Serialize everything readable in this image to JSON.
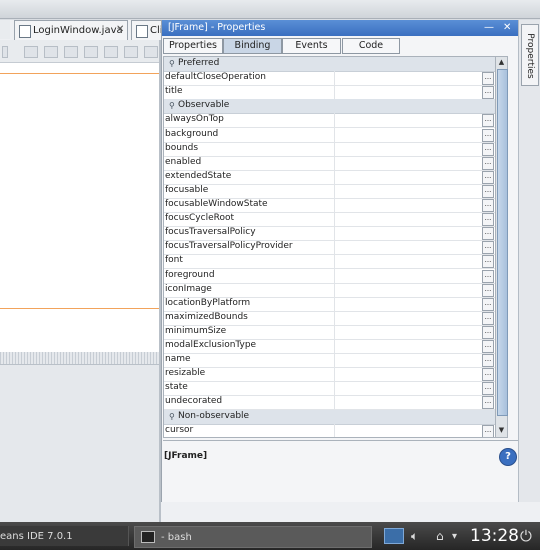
{
  "editor_tabs": [
    {
      "label": "LoginWindow.java"
    },
    {
      "label": "Cli"
    }
  ],
  "properties": {
    "title": "[JFrame] - Properties",
    "tabs": [
      {
        "label": "Properties",
        "selected": false
      },
      {
        "label": "Binding",
        "selected": true
      },
      {
        "label": "Events",
        "selected": false
      },
      {
        "label": "Code",
        "selected": false
      }
    ],
    "rows": [
      {
        "type": "category",
        "label": "Preferred"
      },
      {
        "type": "prop",
        "label": "defaultCloseOperation"
      },
      {
        "type": "prop",
        "label": "title"
      },
      {
        "type": "category",
        "label": "Observable"
      },
      {
        "type": "prop",
        "label": "alwaysOnTop"
      },
      {
        "type": "prop",
        "label": "background"
      },
      {
        "type": "prop",
        "label": "bounds"
      },
      {
        "type": "prop",
        "label": "enabled"
      },
      {
        "type": "prop",
        "label": "extendedState"
      },
      {
        "type": "prop",
        "label": "focusable"
      },
      {
        "type": "prop",
        "label": "focusableWindowState"
      },
      {
        "type": "prop",
        "label": "focusCycleRoot"
      },
      {
        "type": "prop",
        "label": "focusTraversalPolicy"
      },
      {
        "type": "prop",
        "label": "focusTraversalPolicyProvider"
      },
      {
        "type": "prop",
        "label": "font"
      },
      {
        "type": "prop",
        "label": "foreground"
      },
      {
        "type": "prop",
        "label": "iconImage"
      },
      {
        "type": "prop",
        "label": "locationByPlatform"
      },
      {
        "type": "prop",
        "label": "maximizedBounds"
      },
      {
        "type": "prop",
        "label": "minimumSize"
      },
      {
        "type": "prop",
        "label": "modalExclusionType"
      },
      {
        "type": "prop",
        "label": "name"
      },
      {
        "type": "prop",
        "label": "resizable"
      },
      {
        "type": "prop",
        "label": "state"
      },
      {
        "type": "prop",
        "label": "undecorated"
      },
      {
        "type": "category",
        "label": "Non-observable"
      },
      {
        "type": "prop",
        "label": "cursor"
      }
    ],
    "ellipsis_label": "...",
    "description": "[JFrame]",
    "help_label": "?"
  },
  "side_panel": {
    "label": "Properties"
  },
  "taskbar": {
    "task1": "eans IDE 7.0.1",
    "task2": "- bash",
    "clock": "13:28"
  }
}
